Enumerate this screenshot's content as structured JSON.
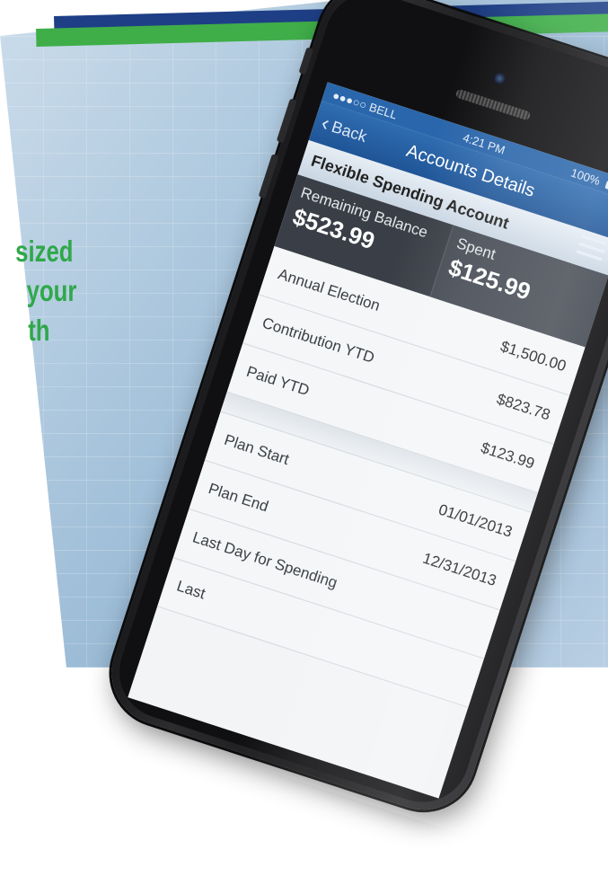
{
  "promo": {
    "line1": "sized",
    "line2": "your",
    "line3": "th"
  },
  "status": {
    "carrier": "●●●○○ BELL",
    "time": "4:21 PM",
    "battery": "100%"
  },
  "nav": {
    "back_label": "Back",
    "title": "Accounts Details"
  },
  "account": {
    "name": "Flexible Spending Account",
    "remaining_label": "Remaining Balance",
    "remaining_value": "$523.99",
    "spent_label": "Spent",
    "spent_value": "$125.99"
  },
  "rows": [
    {
      "label": "Annual Election",
      "value": "$1,500.00"
    },
    {
      "label": "Contribution YTD",
      "value": "$823.78"
    },
    {
      "label": "Paid YTD",
      "value": "$123.99"
    }
  ],
  "plan_rows": [
    {
      "label": "Plan Start",
      "value": "01/01/2013"
    },
    {
      "label": "Plan End",
      "value": "12/31/2013"
    },
    {
      "label": "Last Day for Spending",
      "value": ""
    },
    {
      "label": "Last",
      "value": ""
    }
  ],
  "colors": {
    "navy_stripe": "#1e3f86",
    "green_stripe": "#3fae49",
    "tagline_green": "#2fa84a",
    "navbar_blue": "#2a66ab",
    "summary_dark": "#3a3f47"
  }
}
